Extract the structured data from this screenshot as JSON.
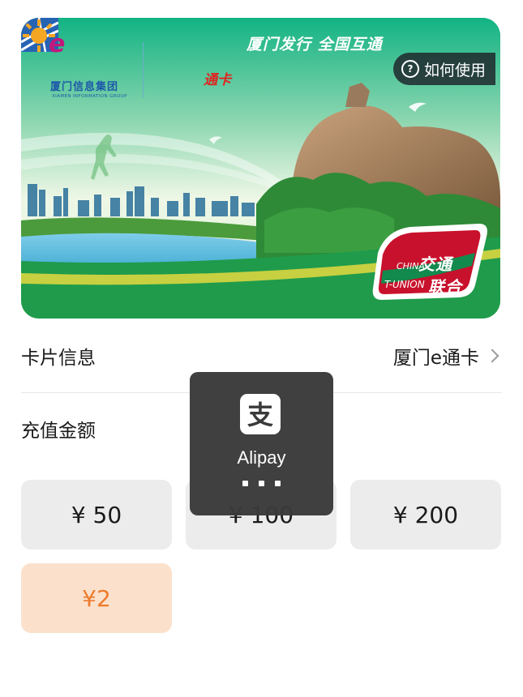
{
  "card": {
    "issuer_logo": "xiamen-information-group-logo",
    "issuer_name": "厦门信息集团",
    "issuer_name_en": "XIAMEN INFORMATION GROUP",
    "ecard_name": "通卡",
    "ecard_e": "e",
    "slogan": "厦门发行 全国互通",
    "howto_label": "如何使用",
    "tunion_cn_top": "交通",
    "tunion_cn_bottom": "联合",
    "tunion_en_top": "CHINA",
    "tunion_en_bottom": "T-UNION",
    "accent": "#1ea35a"
  },
  "card_info": {
    "label": "卡片信息",
    "value": "厦门e通卡"
  },
  "recharge": {
    "label": "充值金额",
    "options": [
      "¥ 50",
      "¥ 100",
      "¥ 200"
    ],
    "custom": "¥2",
    "custom_color": "#ee7a2c"
  },
  "overlay": {
    "app_name": "Alipay",
    "icon": "alipay-icon",
    "icon_glyph": "支"
  }
}
